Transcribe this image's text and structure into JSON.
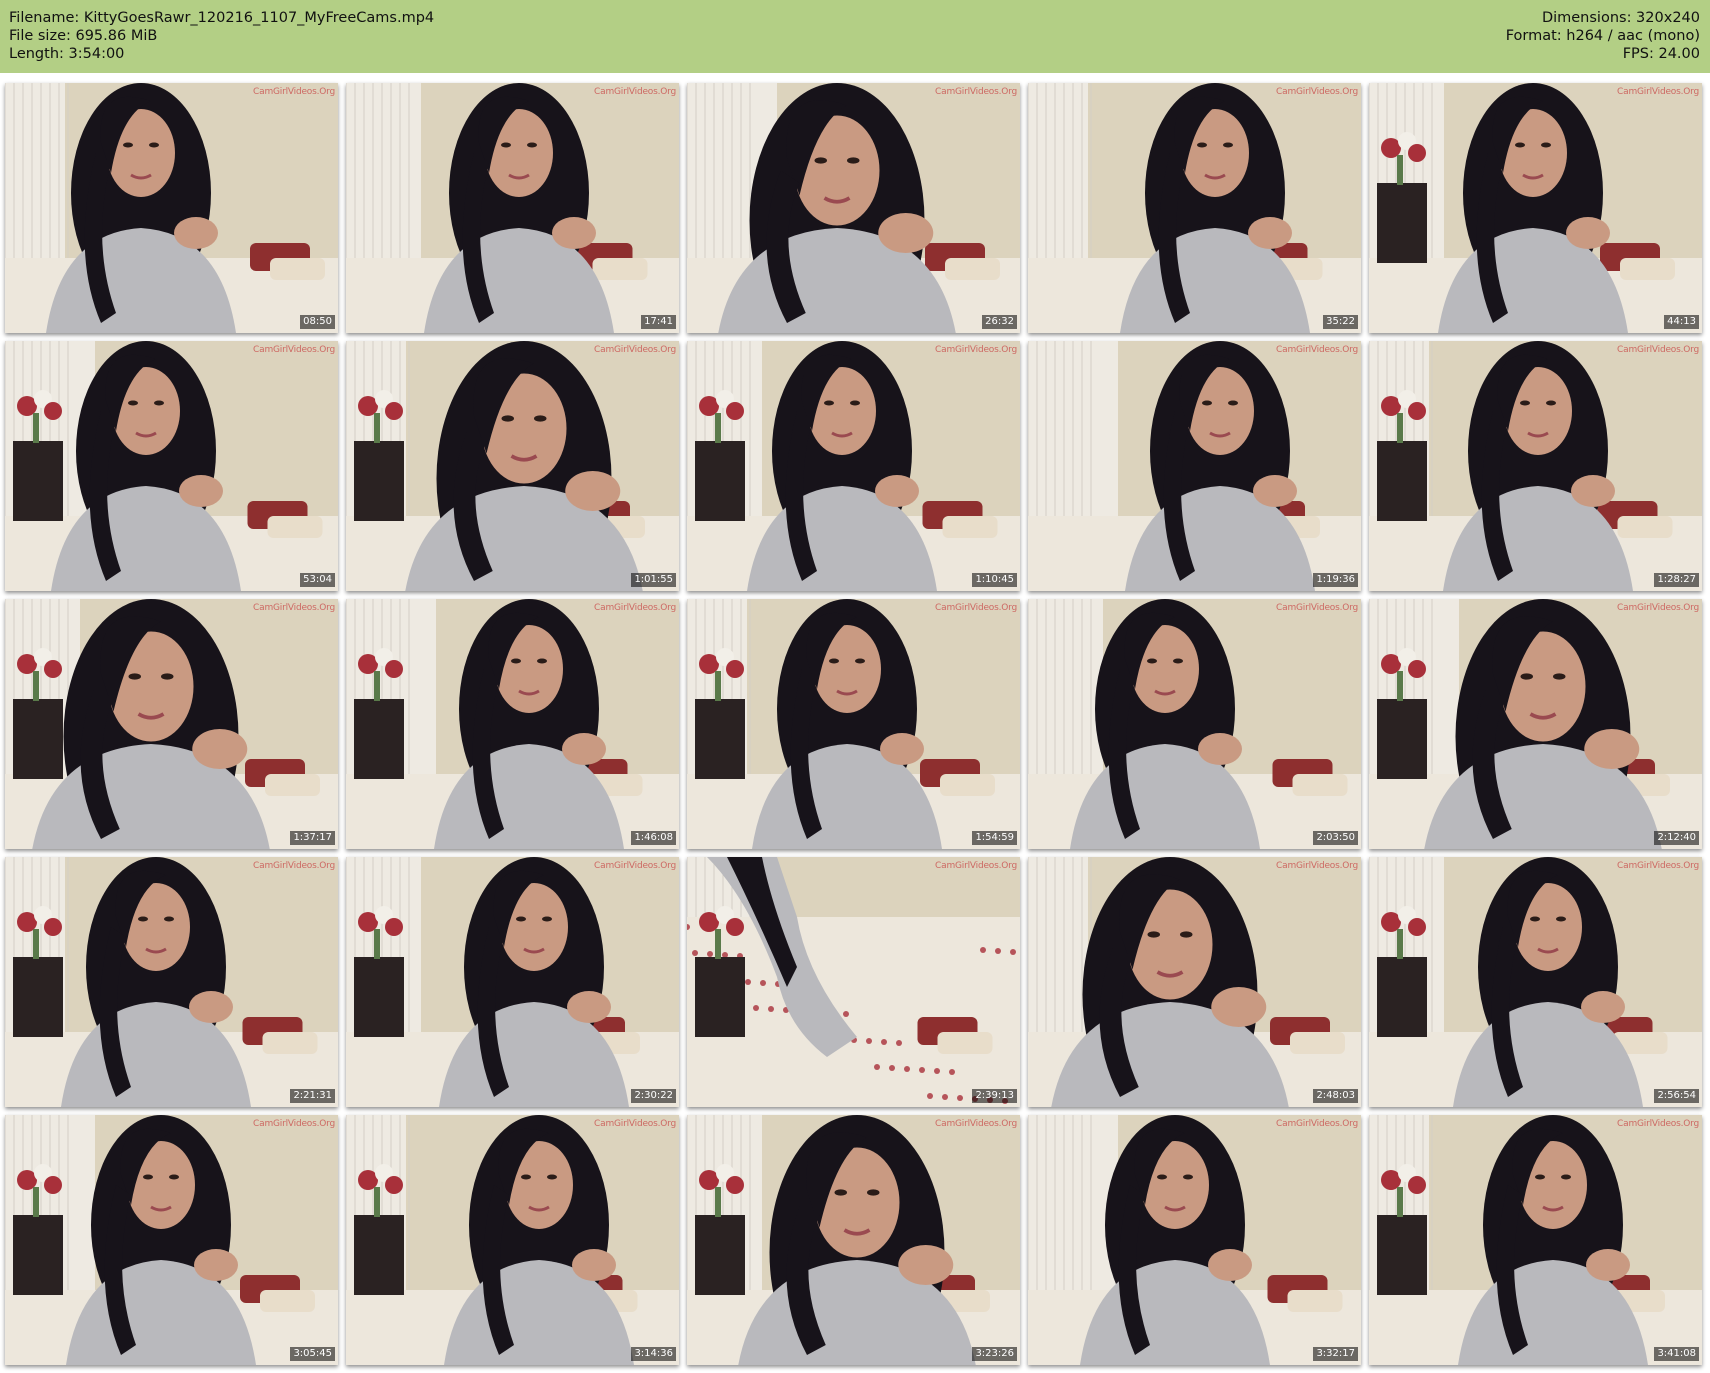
{
  "header": {
    "filename": "Filename: KittyGoesRawr_120216_1107_MyFreeCams.mp4",
    "filesize": "File size: 695.86 MiB",
    "length": "Length: 3:54:00",
    "dimensions": "Dimensions: 320x240",
    "format": "Format: h264 / aac (mono)",
    "fps": "FPS: 24.00"
  },
  "thumbnails": [
    {
      "timestamp": "08:50",
      "watermark": "CamGirlVideos.Org"
    },
    {
      "timestamp": "17:41",
      "watermark": "CamGirlVideos.Org"
    },
    {
      "timestamp": "26:32",
      "watermark": "CamGirlVideos.Org"
    },
    {
      "timestamp": "35:22",
      "watermark": "CamGirlVideos.Org"
    },
    {
      "timestamp": "44:13",
      "watermark": "CamGirlVideos.Org"
    },
    {
      "timestamp": "53:04",
      "watermark": "CamGirlVideos.Org"
    },
    {
      "timestamp": "1:01:55",
      "watermark": "CamGirlVideos.Org"
    },
    {
      "timestamp": "1:10:45",
      "watermark": "CamGirlVideos.Org"
    },
    {
      "timestamp": "1:19:36",
      "watermark": "CamGirlVideos.Org"
    },
    {
      "timestamp": "1:28:27",
      "watermark": "CamGirlVideos.Org"
    },
    {
      "timestamp": "1:37:17",
      "watermark": "CamGirlVideos.Org"
    },
    {
      "timestamp": "1:46:08",
      "watermark": "CamGirlVideos.Org"
    },
    {
      "timestamp": "1:54:59",
      "watermark": "CamGirlVideos.Org"
    },
    {
      "timestamp": "2:03:50",
      "watermark": "CamGirlVideos.Org"
    },
    {
      "timestamp": "2:12:40",
      "watermark": "CamGirlVideos.Org"
    },
    {
      "timestamp": "2:21:31",
      "watermark": "CamGirlVideos.Org"
    },
    {
      "timestamp": "2:30:22",
      "watermark": "CamGirlVideos.Org"
    },
    {
      "timestamp": "2:39:13",
      "watermark": "CamGirlVideos.Org"
    },
    {
      "timestamp": "2:48:03",
      "watermark": "CamGirlVideos.Org"
    },
    {
      "timestamp": "2:56:54",
      "watermark": "CamGirlVideos.Org"
    },
    {
      "timestamp": "3:05:45",
      "watermark": "CamGirlVideos.Org"
    },
    {
      "timestamp": "3:14:36",
      "watermark": "CamGirlVideos.Org"
    },
    {
      "timestamp": "3:23:26",
      "watermark": "CamGirlVideos.Org"
    },
    {
      "timestamp": "3:32:17",
      "watermark": "CamGirlVideos.Org"
    },
    {
      "timestamp": "3:41:08",
      "watermark": "CamGirlVideos.Org"
    }
  ],
  "colors": {
    "header_bg": "#b3cf85",
    "wall": "#dcd3bd",
    "blinds": "#eeeae2",
    "hair": "#17131a",
    "sweater": "#b9b9bd",
    "skin": "#c99a82",
    "bedding": "#ede7dc",
    "flowers": "#a8303a",
    "timestamp_bg": "#000000"
  }
}
